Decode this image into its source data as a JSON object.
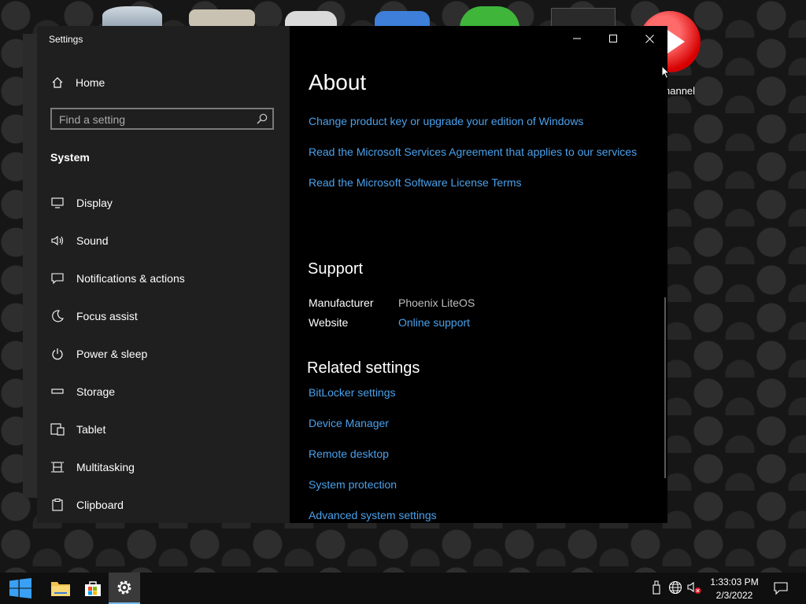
{
  "desktop": {
    "label_youtube": "hannel"
  },
  "window": {
    "title": "Settings"
  },
  "nav": {
    "home_label": "Home",
    "search_placeholder": "Find a setting",
    "section_title": "System",
    "items": [
      {
        "label": "Display",
        "icon": "display-icon"
      },
      {
        "label": "Sound",
        "icon": "sound-icon"
      },
      {
        "label": "Notifications & actions",
        "icon": "notifications-icon"
      },
      {
        "label": "Focus assist",
        "icon": "moon-icon"
      },
      {
        "label": "Power & sleep",
        "icon": "power-icon"
      },
      {
        "label": "Storage",
        "icon": "storage-icon"
      },
      {
        "label": "Tablet",
        "icon": "tablet-icon"
      },
      {
        "label": "Multitasking",
        "icon": "multitasking-icon"
      },
      {
        "label": "Clipboard",
        "icon": "clipboard-icon"
      }
    ]
  },
  "content": {
    "title": "About",
    "about_links": [
      "Change product key or upgrade your edition of Windows",
      "Read the Microsoft Services Agreement that applies to our services",
      "Read the Microsoft Software License Terms"
    ],
    "support": {
      "title": "Support",
      "manufacturer_label": "Manufacturer",
      "manufacturer_value": "Phoenix LiteOS",
      "website_label": "Website",
      "website_value": "Online support"
    },
    "related": {
      "title": "Related settings",
      "links": [
        "BitLocker settings",
        "Device Manager",
        "Remote desktop",
        "System protection",
        "Advanced system settings"
      ]
    }
  },
  "taskbar": {
    "time": "1:33:03 PM",
    "date": "2/3/2022"
  },
  "colors": {
    "accent_link": "#4aa1ec",
    "nav_bg": "#1f1f1f",
    "content_bg": "#000000",
    "taskbar_bg": "#0f0f0f"
  }
}
